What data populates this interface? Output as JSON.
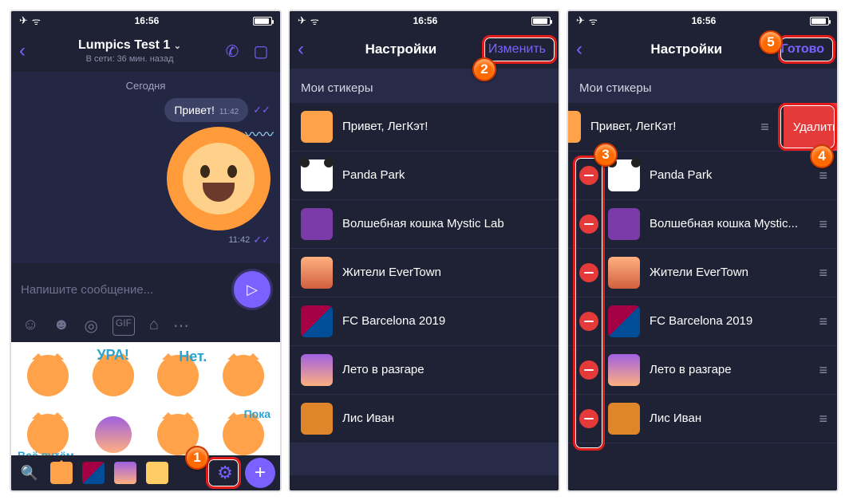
{
  "statusbar": {
    "time": "16:56"
  },
  "chat": {
    "title": "Lumpics Test 1",
    "subtitle": "В сети: 36 мин. назад",
    "day": "Сегодня",
    "msg1": {
      "text": "Привет!",
      "time": "11:42"
    },
    "sticker_time": "11:42",
    "placeholder": "Напишите сообщение...",
    "panel": {
      "cells": [
        "",
        "УРА!",
        "Нет.",
        "",
        "Всё путём",
        "",
        "",
        "Пока"
      ]
    }
  },
  "settings": {
    "title": "Настройки",
    "edit": "Изменить",
    "done": "Готово",
    "section": "Мои стикеры",
    "delete": "Удалить",
    "packs": [
      "Привет, ЛегКэт!",
      "Panda Park",
      "Волшебная кошка Mystic Lab",
      "Жители EverTown",
      "FC Barcelona 2019",
      "Лето в разгаре",
      "Лис Иван"
    ],
    "packs_short": [
      "Привет, ЛегКэт!",
      "Panda Park",
      "Волшебная кошка Mystic...",
      "Жители EverTown",
      "FC Barcelona 2019",
      "Лето в разгаре",
      "Лис Иван"
    ]
  },
  "badges": {
    "b1": "1",
    "b2": "2",
    "b3": "3",
    "b4": "4",
    "b5": "5"
  }
}
